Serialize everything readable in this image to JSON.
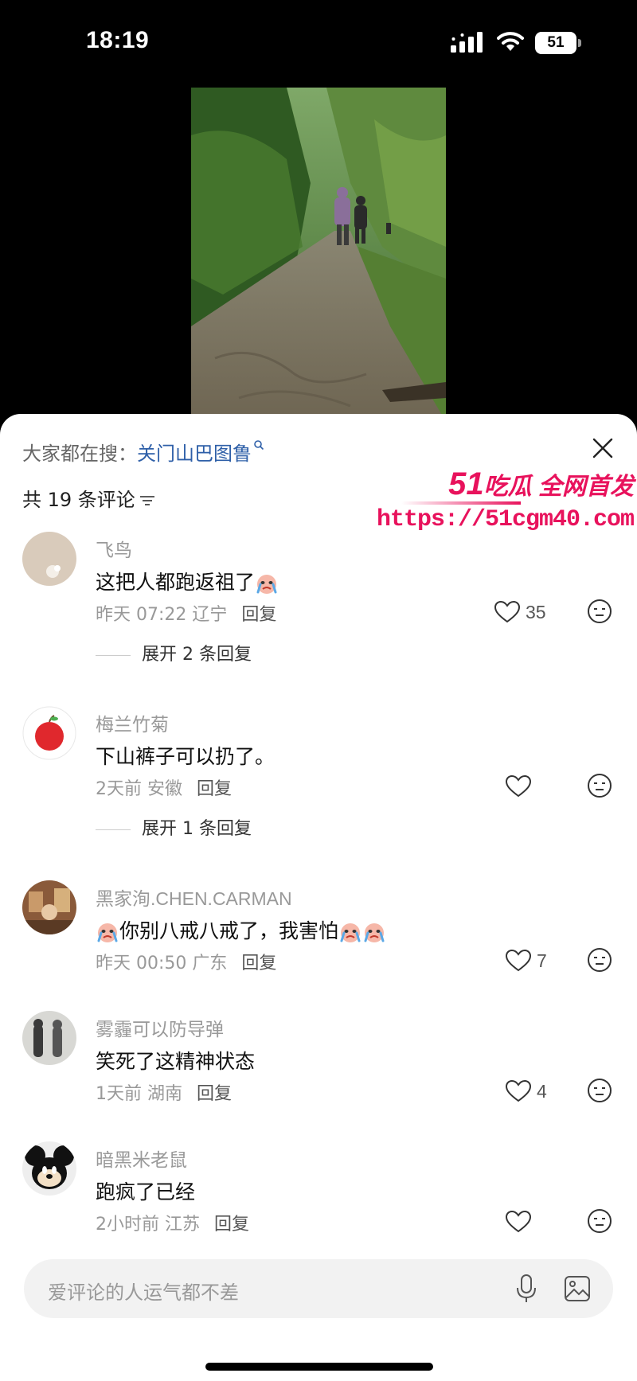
{
  "status_bar": {
    "time": "18:19",
    "battery": "51"
  },
  "sheet": {
    "search_prefix": "大家都在搜：",
    "search_term": "关门山巴图鲁",
    "comment_count_label": "共 19 条评论"
  },
  "watermark": {
    "line1_num": "51",
    "line1_text": "吃瓜 全网首发",
    "url": "https://51cgm40.com"
  },
  "comments": [
    {
      "user": "飞鸟",
      "text": "这把人都跑返祖了",
      "time": "昨天 07:22",
      "location": "辽宁",
      "reply": "回复",
      "likes": "35",
      "expand": "展开 2 条回复"
    },
    {
      "user": "梅兰竹菊",
      "text": "下山裤子可以扔了。",
      "time": "2天前",
      "location": "安徽",
      "reply": "回复",
      "likes": "",
      "expand": "展开 1 条回复"
    },
    {
      "user": "黑家洵.CHEN.CARMAN",
      "text": "你别八戒八戒了，我害怕",
      "time": "昨天 00:50",
      "location": "广东",
      "reply": "回复",
      "likes": "7"
    },
    {
      "user": "雾霾可以防导弹",
      "text": "笑死了这精神状态",
      "time": "1天前",
      "location": "湖南",
      "reply": "回复",
      "likes": "4"
    },
    {
      "user": "暗黑米老鼠",
      "text": "跑疯了已经",
      "time": "2小时前",
      "location": "江苏",
      "reply": "回复",
      "likes": ""
    }
  ],
  "input": {
    "placeholder": "爱评论的人运气都不差"
  },
  "colors": {
    "accent_link": "#2e5fa8",
    "watermark": "#e8125c"
  }
}
